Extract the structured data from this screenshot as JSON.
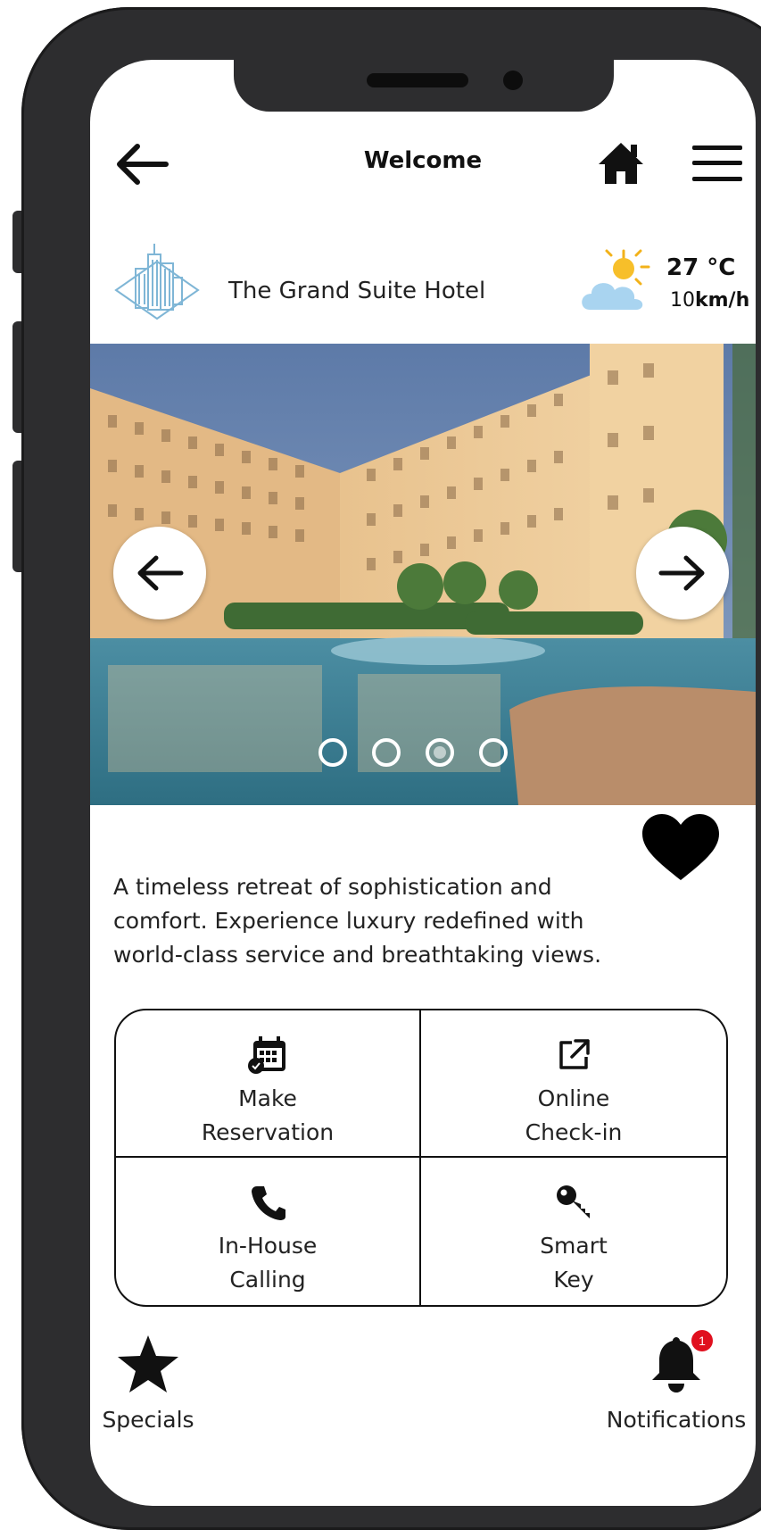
{
  "header": {
    "title": "Welcome"
  },
  "hotel": {
    "name": "The Grand Suite Hotel"
  },
  "weather": {
    "temperature": "27 °C",
    "wind_value": "10",
    "wind_unit": "km/h"
  },
  "carousel": {
    "slide_count": 4,
    "active_slide": 3
  },
  "description": "A timeless retreat of sophistication and comfort. Experience luxury redefined with world-class service and breathtaking views.",
  "actions": [
    {
      "label": "Make\nReservation",
      "icon": "calendar-icon"
    },
    {
      "label": "Online\nCheck-in",
      "icon": "external-link-icon"
    },
    {
      "label": "In-House\nCalling",
      "icon": "phone-icon"
    },
    {
      "label": "Smart\nKey",
      "icon": "key-icon"
    }
  ],
  "bottom": {
    "specials_label": "Specials",
    "notifications_label": "Notifications",
    "notification_count": "1"
  },
  "colors": {
    "frame": "#2d2d2f",
    "badge": "#e0101e",
    "logo": "#7fb6d6"
  }
}
